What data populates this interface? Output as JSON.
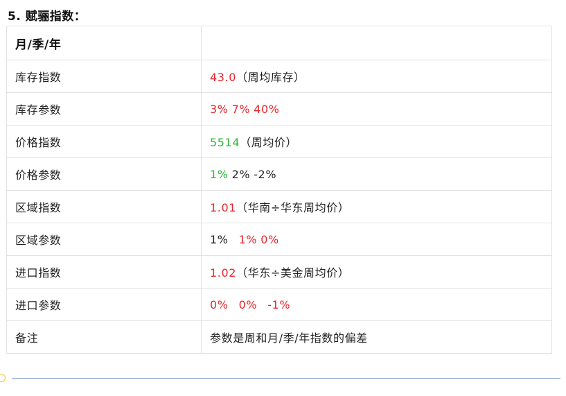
{
  "heading": "5. 赋骊指数：",
  "header_row": {
    "label": "月/季/年",
    "value": ""
  },
  "rows": [
    {
      "label": "库存指数",
      "value": [
        {
          "text": "43.0",
          "color": "red"
        },
        {
          "text": "（周均库存）",
          "color": "dark"
        }
      ]
    },
    {
      "label": "库存参数",
      "value": [
        {
          "text": "3%",
          "color": "red"
        },
        {
          "text": "7%",
          "color": "red"
        },
        {
          "text": "40%",
          "color": "red"
        }
      ]
    },
    {
      "label": "价格指数",
      "value": [
        {
          "text": "5514",
          "color": "green"
        },
        {
          "text": "（周均价）",
          "color": "dark"
        }
      ]
    },
    {
      "label": "价格参数",
      "value": [
        {
          "text": "1%",
          "color": "green"
        },
        {
          "text": "2%",
          "color": "dark"
        },
        {
          "text": "-2%",
          "color": "dark"
        }
      ]
    },
    {
      "label": "区域指数",
      "value": [
        {
          "text": "1.01",
          "color": "red"
        },
        {
          "text": "（华南÷华东周均价）",
          "color": "dark"
        }
      ]
    },
    {
      "label": "区域参数",
      "value": [
        {
          "text": "1%",
          "color": "dark"
        },
        {
          "text": "1%",
          "color": "red"
        },
        {
          "text": "0%",
          "color": "red"
        }
      ]
    },
    {
      "label": "进口指数",
      "value": [
        {
          "text": "1.02",
          "color": "red"
        },
        {
          "text": "（华东÷美金周均价）",
          "color": "dark"
        }
      ]
    },
    {
      "label": "进口参数",
      "value": [
        {
          "text": "0%",
          "color": "red"
        },
        {
          "text": "0%",
          "color": "red"
        },
        {
          "text": "-1%",
          "color": "red"
        }
      ]
    },
    {
      "label": "备注",
      "value": [
        {
          "text": "参数是周和月/季/年指数的偏差",
          "color": "dark"
        }
      ]
    }
  ],
  "colors": {
    "red": "#e8262b",
    "green": "#2fb53a",
    "dark": "#222222",
    "border": "#e2e2e2",
    "divider": "#8fa9db",
    "circle": "#f3c23b"
  }
}
